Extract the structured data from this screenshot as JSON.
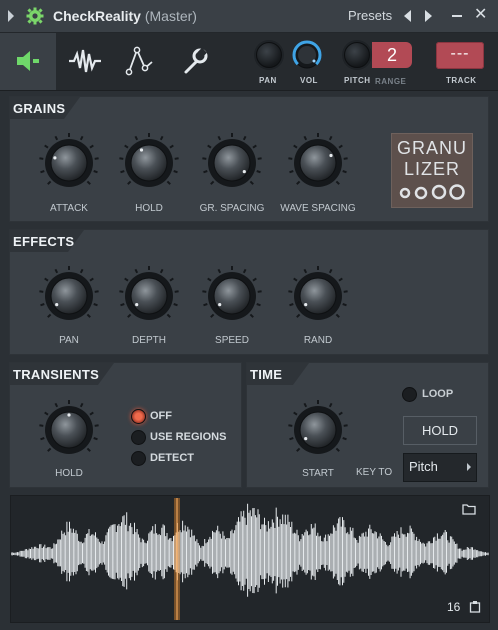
{
  "window": {
    "title": "CheckReality",
    "subtitle": "(Master)",
    "presets_label": "Presets"
  },
  "toolbar": {
    "tabs": [
      "speaker",
      "waveform",
      "envelope",
      "wrench"
    ],
    "pan_label": "PAN",
    "vol_label": "VOL",
    "pitch_label": "PITCH",
    "range_label": "RANGE",
    "pitch_value": "2",
    "track_value": "---",
    "track_label": "TRACK"
  },
  "grains": {
    "title": "GRAINS",
    "knobs": [
      "ATTACK",
      "HOLD",
      "GR. SPACING",
      "WAVE SPACING"
    ],
    "logo_line1": "GRANU",
    "logo_line2": "LIZER"
  },
  "effects": {
    "title": "EFFECTS",
    "knobs": [
      "PAN",
      "DEPTH",
      "SPEED",
      "RAND"
    ]
  },
  "transients": {
    "title": "TRANSIENTS",
    "knob": "HOLD",
    "options": [
      "OFF",
      "USE REGIONS",
      "DETECT"
    ],
    "selected": "OFF"
  },
  "time": {
    "title": "TIME",
    "knob": "START",
    "loop_label": "LOOP",
    "hold_button": "HOLD",
    "key_to_label": "KEY TO",
    "key_to_value": "Pitch"
  },
  "waveform": {
    "count": "16"
  },
  "colors": {
    "accent": "#6fd86a",
    "vol_ring": "#3fa4e6",
    "red": "#b24a55",
    "radio_on": "#f06a4c",
    "playhead": "#e0862a"
  }
}
